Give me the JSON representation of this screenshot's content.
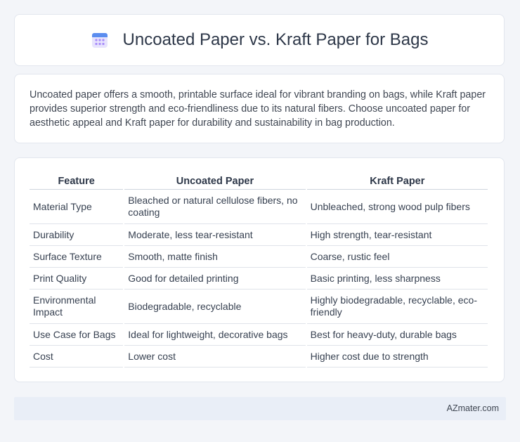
{
  "header": {
    "title": "Uncoated Paper vs. Kraft Paper for Bags",
    "icon": "calendar-icon"
  },
  "summary": {
    "text": "Uncoated paper offers a smooth, printable surface ideal for vibrant branding on bags, while Kraft paper provides superior strength and eco-friendliness due to its natural fibers. Choose uncoated paper for aesthetic appeal and Kraft paper for durability and sustainability in bag production."
  },
  "table": {
    "headers": [
      "Feature",
      "Uncoated Paper",
      "Kraft Paper"
    ],
    "rows": [
      [
        "Material Type",
        "Bleached or natural cellulose fibers, no coating",
        "Unbleached, strong wood pulp fibers"
      ],
      [
        "Durability",
        "Moderate, less tear-resistant",
        "High strength, tear-resistant"
      ],
      [
        "Surface Texture",
        "Smooth, matte finish",
        "Coarse, rustic feel"
      ],
      [
        "Print Quality",
        "Good for detailed printing",
        "Basic printing, less sharpness"
      ],
      [
        "Environmental Impact",
        "Biodegradable, recyclable",
        "Highly biodegradable, recyclable, eco-friendly"
      ],
      [
        "Use Case for Bags",
        "Ideal for lightweight, decorative bags",
        "Best for heavy-duty, durable bags"
      ],
      [
        "Cost",
        "Lower cost",
        "Higher cost due to strength"
      ]
    ]
  },
  "footer": {
    "site": "AZmater.com"
  },
  "colors": {
    "background": "#f3f5f9",
    "card": "#ffffff",
    "footer": "#e9eef7",
    "icon_accent": "#8b7cf6"
  }
}
